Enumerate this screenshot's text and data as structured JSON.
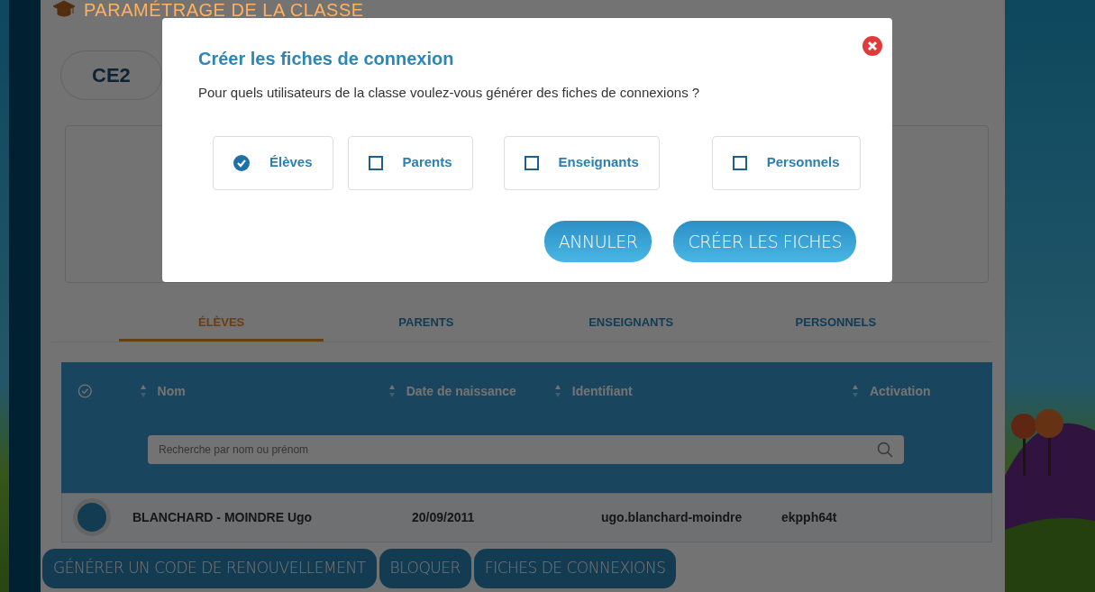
{
  "page": {
    "title": "PARAMÉTRAGE DE LA CLASSE",
    "class_name": "CE2",
    "tabs": [
      {
        "label": "ÉLÈVES",
        "selected": true
      },
      {
        "label": "PARENTS",
        "selected": false
      },
      {
        "label": "ENSEIGNANTS",
        "selected": false
      },
      {
        "label": "PERSONNELS",
        "selected": false
      }
    ],
    "table": {
      "columns": [
        "Nom",
        "Date de naissance",
        "Identifiant",
        "Activation"
      ],
      "search": {
        "placeholder": "Recherche par nom ou prénom"
      },
      "rows": [
        {
          "cells": [
            "BLANCHARD - MOINDRE Ugo",
            "20/09/2011",
            "ugo.blanchard-moindre",
            "ekpph64t"
          ]
        }
      ]
    },
    "actions": [
      "GÉNÉRER UN CODE DE RENOUVELLEMENT",
      "BLOQUER",
      "FICHES DE CONNEXIONS"
    ]
  },
  "dialog": {
    "title": "Créer les fiches de connexion",
    "question": "Pour quels utilisateurs de la classe voulez-vous générer des fiches de connexions ?",
    "options": [
      {
        "label": "Élèves",
        "checked": true
      },
      {
        "label": "Parents",
        "checked": false
      },
      {
        "label": "Enseignants",
        "checked": false
      },
      {
        "label": "Personnels",
        "checked": false
      }
    ],
    "buttons": [
      "ANNULER",
      "CRÉER LES FICHES"
    ]
  }
}
